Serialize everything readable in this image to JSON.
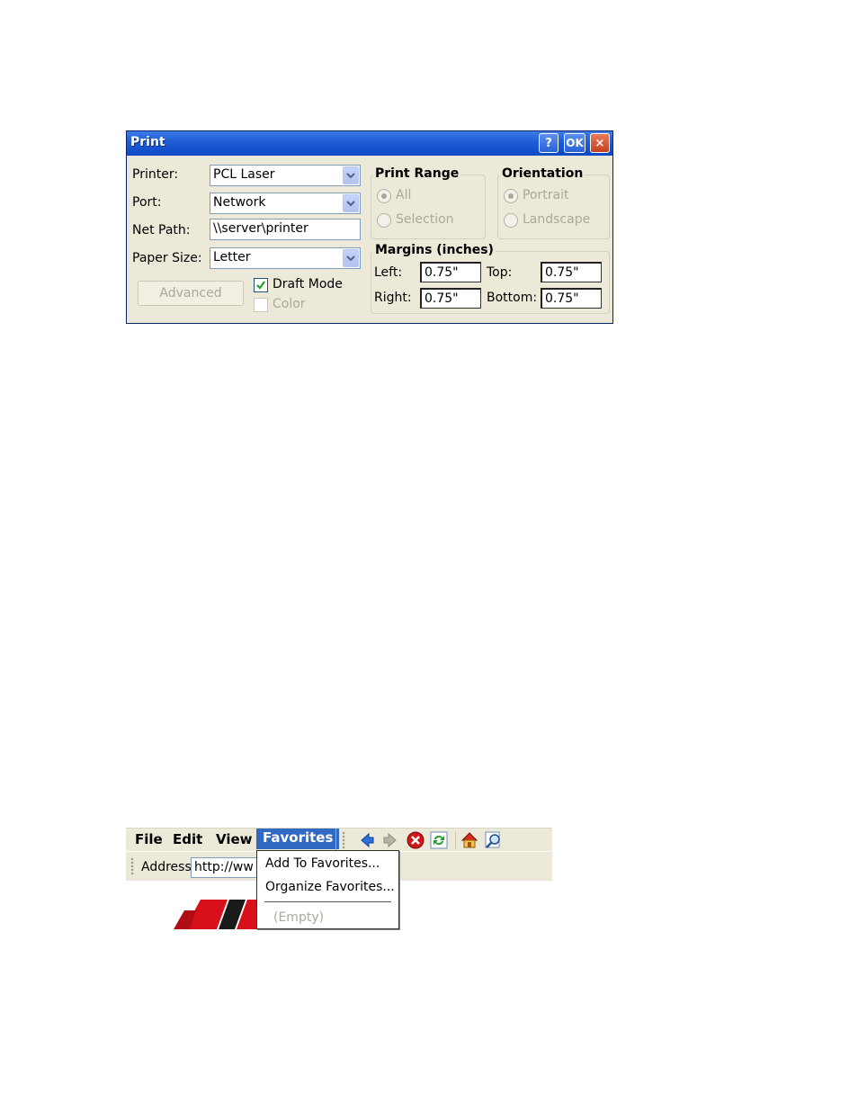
{
  "print_dialog": {
    "title": "Print",
    "title_buttons": {
      "help": "?",
      "ok": "OK",
      "close": "×"
    },
    "printer": {
      "label": "Printer:",
      "value": "PCL Laser"
    },
    "port": {
      "label": "Port:",
      "value": "Network"
    },
    "net_path": {
      "label": "Net Path:",
      "value": "\\\\server\\printer"
    },
    "paper_size": {
      "label": "Paper Size:",
      "value": "Letter"
    },
    "advanced_button": "Advanced",
    "draft_mode": {
      "label": "Draft Mode",
      "checked": true
    },
    "color": {
      "label": "Color",
      "checked": false,
      "disabled": true
    },
    "print_range": {
      "title": "Print Range",
      "options": [
        {
          "label": "All",
          "selected": true
        },
        {
          "label": "Selection",
          "selected": false
        }
      ]
    },
    "orientation": {
      "title": "Orientation",
      "options": [
        {
          "label": "Portrait",
          "selected": true
        },
        {
          "label": "Landscape",
          "selected": false
        }
      ]
    },
    "margins": {
      "title": "Margins (inches)",
      "left": {
        "label": "Left:",
        "value": "0.75\""
      },
      "top": {
        "label": "Top:",
        "value": "0.75\""
      },
      "right": {
        "label": "Right:",
        "value": "0.75\""
      },
      "bottom": {
        "label": "Bottom:",
        "value": "0.75\""
      }
    }
  },
  "browser": {
    "menu": [
      "File",
      "Edit",
      "View",
      "Favorites"
    ],
    "active_menu": "Favorites",
    "toolbar_icons": [
      "back-icon",
      "forward-icon",
      "stop-icon",
      "refresh-icon",
      "home-icon",
      "search-icon"
    ],
    "address": {
      "label": "Address",
      "value": "http://ww"
    },
    "favorites_menu": {
      "items": [
        "Add To Favorites...",
        "Organize Favorites..."
      ],
      "empty_label": "(Empty)"
    }
  }
}
